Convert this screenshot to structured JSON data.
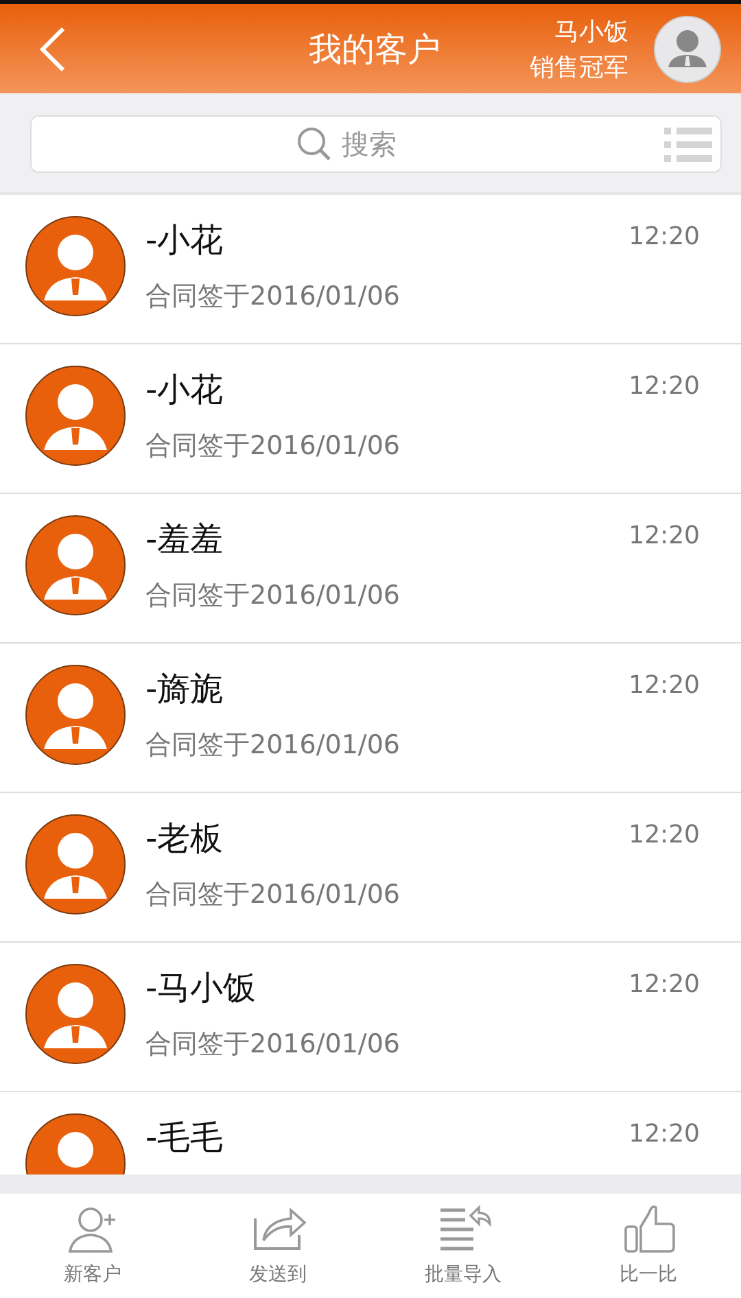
{
  "header": {
    "title": "我的客户",
    "user_name": "马小饭",
    "user_title": "销售冠军"
  },
  "search": {
    "placeholder": "搜索"
  },
  "customers": [
    {
      "name": "-小花",
      "time": "12:20",
      "contract": "合同签于2016/01/06"
    },
    {
      "name": "-小花",
      "time": "12:20",
      "contract": "合同签于2016/01/06"
    },
    {
      "name": "-羞羞",
      "time": "12:20",
      "contract": "合同签于2016/01/06"
    },
    {
      "name": "-旖旎",
      "time": "12:20",
      "contract": "合同签于2016/01/06"
    },
    {
      "name": "-老板",
      "time": "12:20",
      "contract": "合同签于2016/01/06"
    },
    {
      "name": "-马小饭",
      "time": "12:20",
      "contract": "合同签于2016/01/06"
    },
    {
      "name": "-毛毛",
      "time": "12:20"
    }
  ],
  "tabs": [
    {
      "kind": "add-user",
      "label": "新客户"
    },
    {
      "kind": "share",
      "label": "发送到"
    },
    {
      "kind": "import",
      "label": "批量导入"
    },
    {
      "kind": "like",
      "label": "比一比"
    }
  ]
}
